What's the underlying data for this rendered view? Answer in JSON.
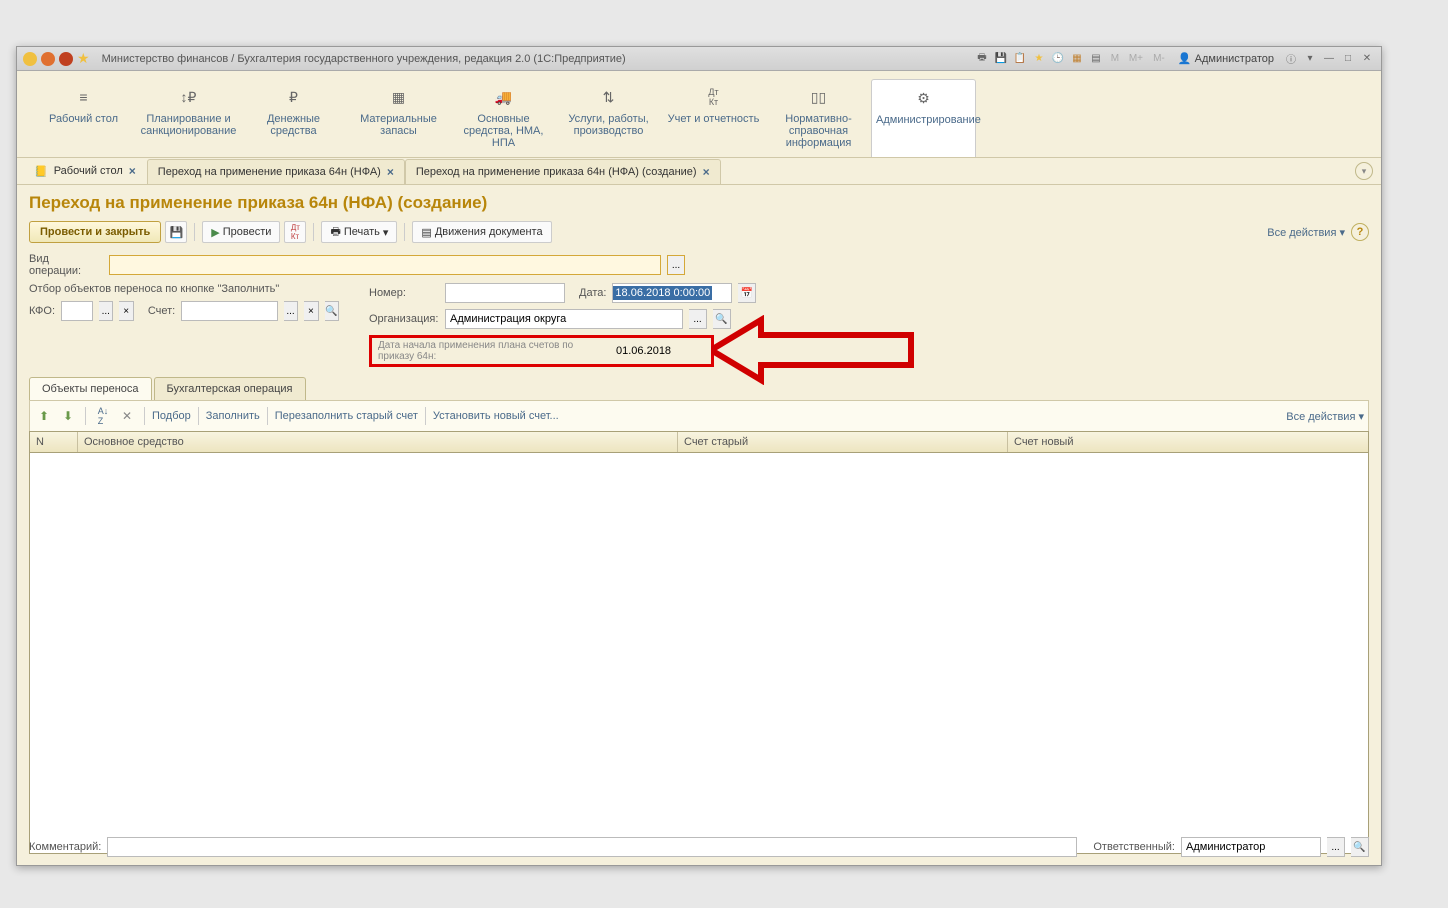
{
  "titlebar": {
    "title": "Министерство финансов / Бухгалтерия государственного учреждения, редакция 2.0  (1С:Предприятие)",
    "user": "Администратор",
    "m": "M",
    "mplus": "M+",
    "mminus": "M-"
  },
  "nav": {
    "items": [
      {
        "label": "Рабочий стол",
        "icon": "≡"
      },
      {
        "label": "Планирование и санкционирование",
        "icon": "⇵"
      },
      {
        "label": "Денежные средства",
        "icon": "₽"
      },
      {
        "label": "Материальные запасы",
        "icon": "▦"
      },
      {
        "label": "Основные средства, НМА, НПА",
        "icon": "🚚"
      },
      {
        "label": "Услуги, работы, производство",
        "icon": "⇅"
      },
      {
        "label": "Учет и отчетность",
        "icon": "Дт Кт"
      },
      {
        "label": "Нормативно-справочная информация",
        "icon": "▯▯"
      },
      {
        "label": "Администрирование",
        "icon": "⚙"
      }
    ]
  },
  "tabs": {
    "items": [
      {
        "label": "Рабочий стол",
        "icon": "📒"
      },
      {
        "label": "Переход на применение приказа 64н (НФА)"
      },
      {
        "label": "Переход на применение приказа 64н (НФА) (создание)"
      }
    ]
  },
  "page": {
    "title": "Переход на применение приказа 64н (НФА) (создание)",
    "toolbar": {
      "submit": "Провести и закрыть",
      "conduct": "Провести",
      "print": "Печать",
      "movements": "Движения документа",
      "all_actions": "Все действия"
    },
    "form": {
      "operation_label": "Вид операции:",
      "filter_label": "Отбор объектов переноса по кнопке \"Заполнить\"",
      "kfo_label": "КФО:",
      "account_label": "Счет:",
      "number_label": "Номер:",
      "date_label": "Дата:",
      "date_value": "18.06.2018  0:00:00",
      "org_label": "Организация:",
      "org_value": "Администрация округа",
      "start_date_label": "Дата начала применения плана счетов по приказу 64н:",
      "start_date_value": "01.06.2018"
    },
    "doctabs": {
      "objects": "Объекты переноса",
      "accounting": "Бухгалтерская операция"
    },
    "subtool": {
      "select": "Подбор",
      "fill": "Заполнить",
      "refill": "Перезаполнить старый счет",
      "setnew": "Установить новый счет...",
      "all_actions": "Все действия"
    },
    "grid": {
      "col_n": "N",
      "col_asset": "Основное средство",
      "col_old": "Счет старый",
      "col_new": "Счет новый"
    },
    "footer": {
      "comment_label": "Комментарий:",
      "responsible_label": "Ответственный:",
      "responsible_value": "Администратор"
    }
  }
}
